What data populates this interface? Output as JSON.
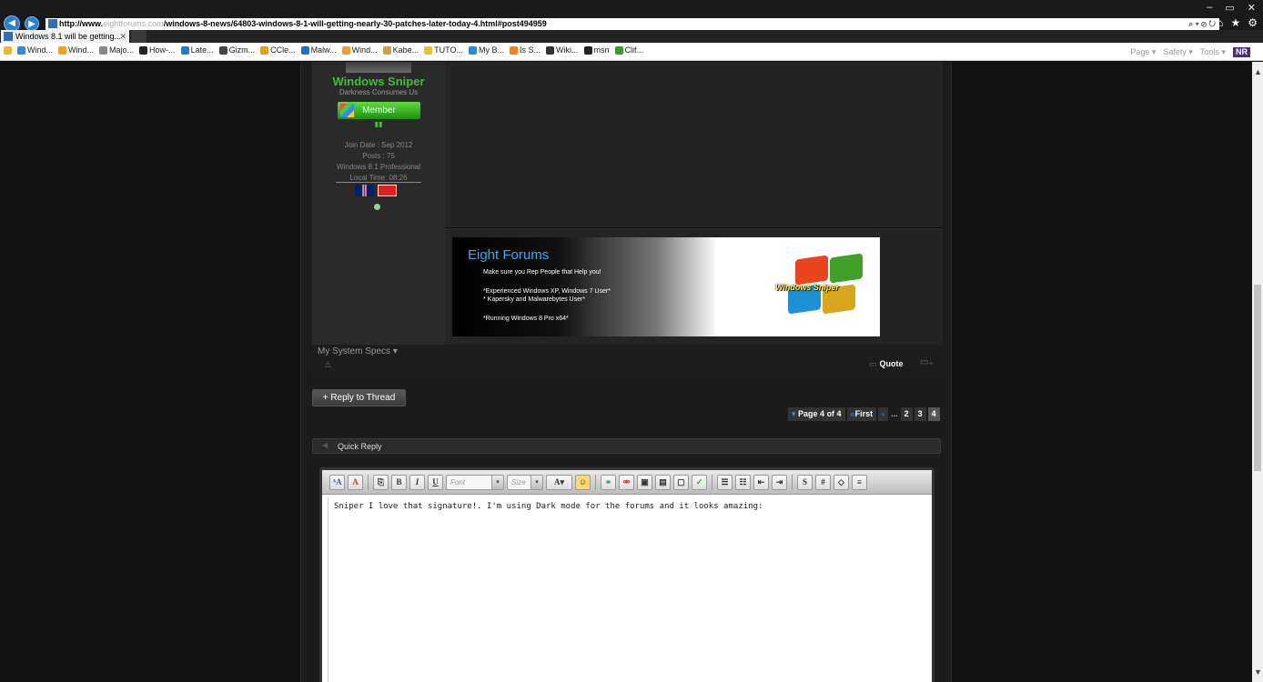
{
  "browser": {
    "window_controls": [
      "–",
      "▭",
      "✕"
    ],
    "address_prefix": "http://www.",
    "address_domain": "eightforums.com",
    "address_path": "/windows-8-news/64803-windows-8-1-will-getting-nearly-30-patches-later-today-4.html#post494959",
    "address_tools": "⌕ ▾ ⊘ ↻",
    "tab_title": "Windows 8.1 will be getting...",
    "tab_close": "✕",
    "favorites": [
      {
        "label": "Wind...",
        "color": "#2e8fd6"
      },
      {
        "label": "Wind...",
        "color": "#f0a020"
      },
      {
        "label": "Majo...",
        "color": "#888888"
      },
      {
        "label": "How-...",
        "color": "#222222"
      },
      {
        "label": "Late...",
        "color": "#1b7fd6"
      },
      {
        "label": "Gizm...",
        "color": "#444444"
      },
      {
        "label": "CCle...",
        "color": "#e0a020"
      },
      {
        "label": "Malw...",
        "color": "#1e6fd0"
      },
      {
        "label": "Wind...",
        "color": "#e8a030"
      },
      {
        "label": "Kabe...",
        "color": "#d0a040"
      },
      {
        "label": "TUTO...",
        "color": "#e8c040"
      },
      {
        "label": "My B...",
        "color": "#1e90d8"
      },
      {
        "label": "Is S...",
        "color": "#f08020"
      },
      {
        "label": "Wiki...",
        "color": "#333333"
      },
      {
        "label": "msn",
        "color": "#222222"
      },
      {
        "label": "Clif...",
        "color": "#3a9a30"
      }
    ],
    "command_bar": [
      "Page ▾",
      "Safety ▾",
      "Tools ▾"
    ],
    "command_badge": "NR"
  },
  "post": {
    "username": "Windows Sniper",
    "user_title": "Darkness Consumes Us",
    "rank": "Member",
    "rank_pips": "▮▮",
    "join_date": "Join Date : Sep 2012",
    "posts": "Posts : 75",
    "os": "Windows 8.1 Professional",
    "local_time": "Local Time: 08:26",
    "signature": {
      "title": "Eight Forums",
      "line1": "Make sure you Rep People that Help you!",
      "line2": "*Experienced Windows XP, Windows 7 User*",
      "line3": "* Kapersky and Malwarebytes User*",
      "line4": "*Running Windows 8 Pro x64*",
      "logo_text": "Windows Sniper"
    },
    "specs_link": "My System Specs ▾",
    "quote_label": "Quote"
  },
  "thread": {
    "reply_button": "+ Reply to Thread",
    "pagination": {
      "page_of": "Page 4 of 4",
      "first": "First",
      "first_arrow": "«",
      "prev_arrow": "‹",
      "ellipsis": "...",
      "pages": [
        "2",
        "3"
      ],
      "current": "4"
    }
  },
  "quick_reply": {
    "label": "Quick Reply",
    "font_placeholder": "Font",
    "size_placeholder": "Size",
    "text": "Sniper I love that signature!. I'm using Dark mode for the forums and it looks amazing:"
  }
}
